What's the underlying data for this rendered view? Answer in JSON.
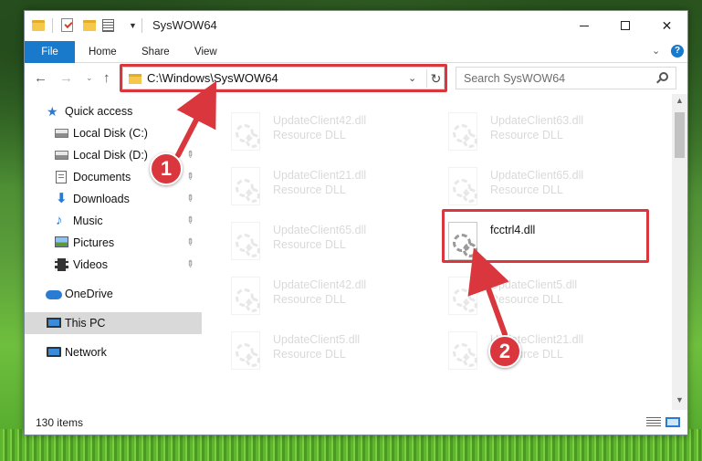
{
  "window": {
    "title": "SysWOW64"
  },
  "ribbon": {
    "tabs": [
      "File",
      "Home",
      "Share",
      "View"
    ]
  },
  "address": {
    "path": "C:\\Windows\\SysWOW64",
    "search_placeholder": "Search SysWOW64"
  },
  "sidebar": {
    "items": [
      {
        "label": "Quick access",
        "icon": "star-icon",
        "pinned": false
      },
      {
        "label": "Local Disk (C:)",
        "icon": "disk-icon",
        "pinned": true
      },
      {
        "label": "Local Disk (D:)",
        "icon": "disk-icon",
        "pinned": true
      },
      {
        "label": "Documents",
        "icon": "documents-icon",
        "pinned": true
      },
      {
        "label": "Downloads",
        "icon": "downloads-icon",
        "pinned": true
      },
      {
        "label": "Music",
        "icon": "music-icon",
        "pinned": true
      },
      {
        "label": "Pictures",
        "icon": "pictures-icon",
        "pinned": true
      },
      {
        "label": "Videos",
        "icon": "videos-icon",
        "pinned": true
      },
      {
        "label": "OneDrive",
        "icon": "onedrive-icon",
        "pinned": false
      },
      {
        "label": "This PC",
        "icon": "this-pc-icon",
        "pinned": false,
        "selected": true
      },
      {
        "label": "Network",
        "icon": "network-icon",
        "pinned": false
      }
    ]
  },
  "files": [
    {
      "name": "UpdateClient42.dll",
      "type": "Resource DLL"
    },
    {
      "name": "UpdateClient63.dll",
      "type": "Resource DLL"
    },
    {
      "name": "UpdateClient21.dll",
      "type": "Resource DLL"
    },
    {
      "name": "UpdateClient65.dll",
      "type": "Resource DLL"
    },
    {
      "name": "UpdateClient65.dll",
      "type": "Resource DLL"
    },
    {
      "name": "fcctrl4.dll",
      "type": ""
    },
    {
      "name": "UpdateClient42.dll",
      "type": "Resource DLL"
    },
    {
      "name": "UpdateClient5.dll",
      "type": "Resource DLL"
    },
    {
      "name": "UpdateClient5.dll",
      "type": "Resource DLL"
    },
    {
      "name": "UpdateClient21.dll",
      "type": "Resource DLL"
    }
  ],
  "status": {
    "item_count": "130 items"
  },
  "callouts": [
    "1",
    "2"
  ],
  "colors": {
    "accent": "#1979ca",
    "highlight": "#d9363e"
  }
}
